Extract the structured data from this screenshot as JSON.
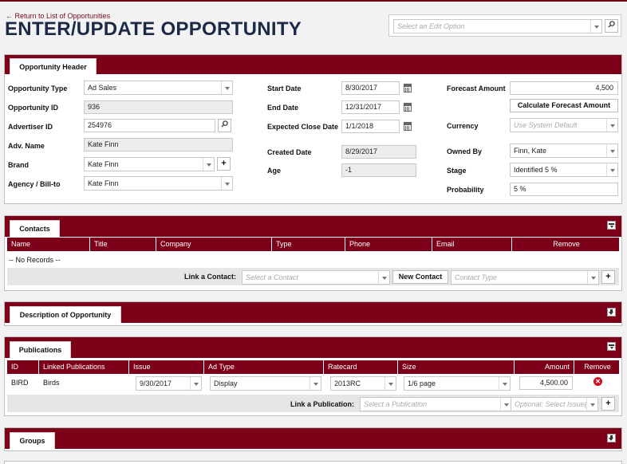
{
  "back_link": "← Return to List of Opportunities",
  "page_title": "ENTER/UPDATE OPPORTUNITY",
  "edit_option": {
    "placeholder": "Select an Edit Option"
  },
  "header": {
    "tab": "Opportunity Header",
    "opportunity_type": {
      "label": "Opportunity Type",
      "value": "Ad Sales"
    },
    "opportunity_id": {
      "label": "Opportunity ID",
      "value": "936"
    },
    "advertiser_id": {
      "label": "Advertiser ID",
      "value": "254976"
    },
    "adv_name": {
      "label": "Adv. Name",
      "value": "Kate Finn"
    },
    "brand": {
      "label": "Brand",
      "value": "Kate Finn"
    },
    "agency": {
      "label": "Agency / Bill-to",
      "value": "Kate Finn"
    },
    "start_date": {
      "label": "Start Date",
      "value": "8/30/2017"
    },
    "end_date": {
      "label": "End Date",
      "value": "12/31/2017"
    },
    "expected_close": {
      "label": "Expected Close Date",
      "value": "1/1/2018"
    },
    "created_date": {
      "label": "Created Date",
      "value": "8/29/2017"
    },
    "age": {
      "label": "Age",
      "value": "-1"
    },
    "forecast_amount": {
      "label": "Forecast Amount",
      "value": "4,500"
    },
    "calc_button": "Calculate Forecast Amount",
    "currency": {
      "label": "Currency",
      "placeholder": "Use System Default"
    },
    "owned_by": {
      "label": "Owned By",
      "value": "Finn, Kate"
    },
    "stage": {
      "label": "Stage",
      "value": "Identified 5 %"
    },
    "probability": {
      "label": "Probability",
      "value": "5 %"
    }
  },
  "contacts": {
    "tab": "Contacts",
    "columns": [
      "Name",
      "Title",
      "Company",
      "Type",
      "Phone",
      "Email",
      "Remove"
    ],
    "empty": "-- No Records --",
    "link_label": "Link a Contact:",
    "contact_placeholder": "Select a Contact",
    "new_contact_button": "New Contact",
    "type_placeholder": "Contact Type"
  },
  "description": {
    "tab": "Description of Opportunity"
  },
  "publications": {
    "tab": "Publications",
    "columns": [
      "ID",
      "Linked Publications",
      "Issue",
      "Ad Type",
      "Ratecard",
      "Size",
      "Amount",
      "Remove"
    ],
    "row": {
      "id": "BIRD",
      "name": "Birds",
      "issue": "9/30/2017",
      "ad_type": "Display",
      "ratecard": "2013RC",
      "size": "1/6 page",
      "amount": "4,500.00"
    },
    "link_label": "Link a Publication:",
    "publication_placeholder": "Select a Publication",
    "issue_placeholder": "Optional: Select Issue(s)"
  },
  "groups": {
    "tab": "Groups"
  },
  "colors": {
    "brand": "#7d0019",
    "title": "#1c2a48",
    "remove": "#cc1122"
  }
}
